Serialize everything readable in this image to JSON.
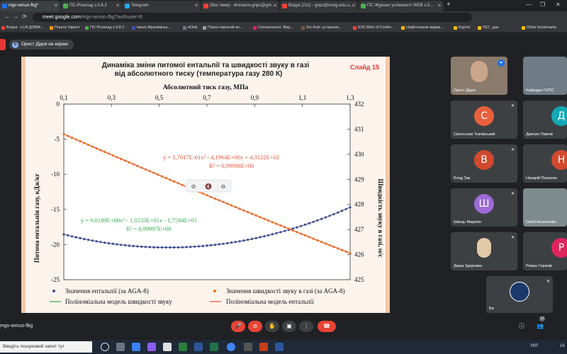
{
  "browser": {
    "tabs": [
      {
        "label": "mgv-wmuo-fbg*",
        "active": true,
        "color": "#1a73e8"
      },
      {
        "label": "ПС-Розклад v.3.8.2",
        "color": "#4caf50"
      },
      {
        "label": "Telegram",
        "color": "#29a9eb"
      },
      {
        "label": "(без теми) - drvivarov.gnps@gm...",
        "color": "#ea4335"
      },
      {
        "label": "Вхідні (211) - gnps@nung.edu.u...",
        "color": "#ea4335"
      },
      {
        "label": "ПС-Журнал успішності WEB v.3...",
        "color": "#4caf50"
      }
    ],
    "new_tab": "+",
    "window_controls": {
      "minimize": "—",
      "maximize": "❐",
      "close": "✕"
    },
    "address": {
      "host": "meet.google.com",
      "path": "/mgv-wmuo-fbg?authuser=6"
    },
    "nav": {
      "back": "←",
      "forward": "→",
      "reload": "⟳"
    },
    "bookmarks": [
      {
        "label": "Вхідні - LUA ДОВЖ...",
        "color": "#ea4335"
      },
      {
        "label": "Пошта Укрнет",
        "color": "#ff9800"
      },
      {
        "label": "ПС-Розклад v.3.8.2",
        "color": "#4caf50"
      },
      {
        "label": "Івано-Франківськ...",
        "color": "#3f51b5"
      },
      {
        "label": "eDisk",
        "color": "#607d8b"
      },
      {
        "label": "Поиск научной ин...",
        "color": "#9e9e9e"
      },
      {
        "label": "Compression: Вир...",
        "color": "#e91e63"
      },
      {
        "label": "Sci-Hub: устраняя...",
        "color": "#795548"
      },
      {
        "label": "E3S Web of Confer...",
        "color": "#f44336"
      },
      {
        "label": "Нафтогазові видав...",
        "color": "#ffc107"
      },
      {
        "label": "Курпої",
        "color": "#ffc107"
      },
      {
        "label": "ISO _gas",
        "color": "#ffc107"
      },
      {
        "label": "Other bookmarks",
        "color": "#ffc107"
      }
    ]
  },
  "meet": {
    "presenter_count": "0",
    "presenter_label": "Орест Дідок на екрані",
    "meeting_code": "mgv-wmuo-fbg",
    "participant_badge": "12",
    "controls": {
      "mic": "🎤",
      "camera": "⊘",
      "hand": "✋",
      "present": "▣",
      "more": "⋮",
      "end": "☎",
      "info": "ⓘ",
      "people": "👥"
    },
    "participants": [
      {
        "name": "Орест Дідок",
        "type": "photo"
      },
      {
        "name": "Кафедра ГНПС",
        "type": "photo"
      },
      {
        "name": "Святослав Ткачівський",
        "initial": "С",
        "color": "#e8603c"
      },
      {
        "name": "Дмитро Павлів",
        "initial": "Д",
        "color": "#13a8b5"
      },
      {
        "name": "Влад Зак",
        "initial": "В",
        "color": "#d1492e"
      },
      {
        "name": "Назарій Панасюк",
        "initial": "Н",
        "color": "#d1492e"
      },
      {
        "name": "Швець Маркіян",
        "initial": "Ш",
        "color": "#9c6ad6"
      },
      {
        "name": "Daniil Avramenko",
        "type": "photo"
      },
      {
        "name": "Даша Здоровик",
        "type": "photo"
      },
      {
        "name": "Роман Герилів",
        "initial": "Р",
        "color": "#e0245e"
      },
      {
        "name": "Ви",
        "type": "self"
      }
    ],
    "mic_off_icon": "🎙"
  },
  "slide": {
    "title_line1": "Динаміка зміни питомої ентальпії та швидкості звуку в газі",
    "title_line2": "від абсолютного тиску (температура газу 280 К)",
    "slide_number": "Слайд 15",
    "floating_controls": [
      "⊘",
      "🔇",
      "⊖"
    ]
  },
  "chart_data": {
    "type": "scatter",
    "xlabel": "Абсолютний тиск газу, МПа",
    "ylabel_left": "Питома ентальпія газу, кДж/кг",
    "ylabel_right": "Швидкість звуку в газі, м/с",
    "x_ticks": [
      "0,1",
      "0,3",
      "0,5",
      "0,7",
      "0,9",
      "1,1",
      "1,3"
    ],
    "y_left_ticks": [
      "0",
      "-5",
      "-10",
      "-15",
      "-20",
      "-25"
    ],
    "y_right_ticks": [
      "432",
      "431",
      "430",
      "429",
      "428",
      "427",
      "426",
      "425"
    ],
    "xlim": [
      0.1,
      1.3
    ],
    "ylim_left": [
      -25,
      0
    ],
    "ylim_right": [
      425,
      432
    ],
    "enthalpy_fit": {
      "a": 9.8189,
      "b": -10.533,
      "c": -17.594
    },
    "sound_speed_fit": {
      "a": 0.17017,
      "b": -4.1964,
      "c": 431.22
    },
    "equation_enthalpy": "y = 9,8189E+00x² - 1,0533E+01x - 1,7594E+01",
    "r2_enthalpy": "R² = 0,99997E+00",
    "equation_speed": "y = 1,7017E-01x² - 4,1964E+00x + 4,3122E+02",
    "r2_speed": "R² = 0,99998E+00",
    "colors": {
      "enthalpy": "#3b4a8f",
      "speed": "#e8731e",
      "fit_green": "#2eaa4a",
      "fit_red": "#e8503a"
    },
    "legend": [
      {
        "label": "Значення ентальпії (за AGA-8)",
        "kind": "dot",
        "color": "#3b4a8f"
      },
      {
        "label": "Значення швидкості звуку в газі (за AGA-8)",
        "kind": "dot",
        "color": "#e8731e"
      },
      {
        "label": "Поліноміальна модель швидкості звуку",
        "kind": "line",
        "color": "#2eaa4a"
      },
      {
        "label": "Поліноміальна модель ентальпії",
        "kind": "line",
        "color": "#e8503a"
      }
    ]
  },
  "taskbar": {
    "search_placeholder": "Введіть пошуковий запит тут",
    "lang": "УКР",
    "time": "16"
  }
}
